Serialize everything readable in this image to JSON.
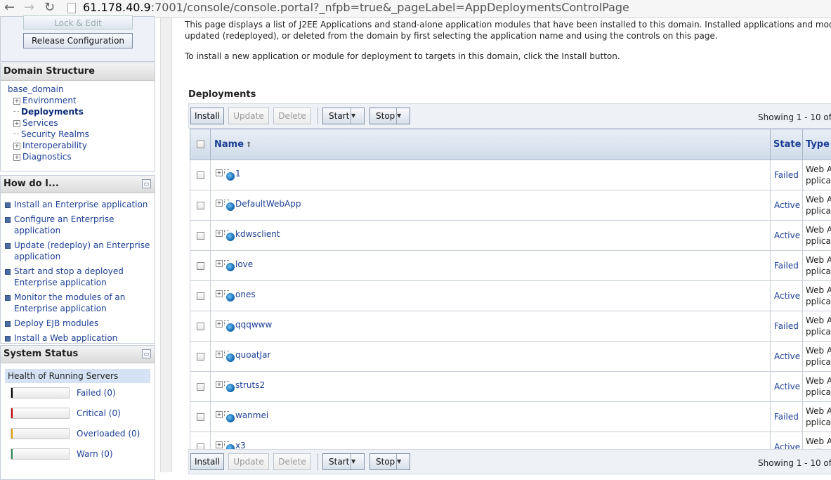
{
  "browser": {
    "url_host": "61.178.40.9",
    "url_rest": ":7001/console/console.portal?_nfpb=true&_pageLabel=AppDeploymentsControlPage"
  },
  "change_center": {
    "lock_edit": "Lock & Edit",
    "release_config": "Release Configuration"
  },
  "domain_structure": {
    "title": "Domain Structure",
    "root": "base_domain",
    "items": [
      {
        "label": "Environment",
        "expandable": true
      },
      {
        "label": "Deployments",
        "expandable": false,
        "selected": true
      },
      {
        "label": "Services",
        "expandable": true
      },
      {
        "label": "Security Realms",
        "expandable": false
      },
      {
        "label": "Interoperability",
        "expandable": true
      },
      {
        "label": "Diagnostics",
        "expandable": true
      }
    ]
  },
  "how_do_i": {
    "title": "How do I...",
    "items": [
      "Install an Enterprise application",
      "Configure an Enterprise application",
      "Update (redeploy) an Enterprise application",
      "Start and stop a deployed Enterprise application",
      "Monitor the modules of an Enterprise application",
      "Deploy EJB modules",
      "Install a Web application"
    ]
  },
  "system_status": {
    "title": "System Status",
    "health_label": "Health of Running Servers",
    "rows": [
      {
        "label": "Failed (0)",
        "color": "#000000"
      },
      {
        "label": "Critical (0)",
        "color": "#cc0000"
      },
      {
        "label": "Overloaded (0)",
        "color": "#e0a000"
      },
      {
        "label": "Warn (0)",
        "color": "#2e8b57"
      }
    ]
  },
  "main": {
    "intro_line1": "This page displays a list of J2EE Applications and stand-alone application modules that have been installed to this domain. Installed applications and modules can",
    "intro_line2": "updated (redeployed), or deleted from the domain by first selecting the application name and using the controls on this page.",
    "intro_line3": "To install a new application or module for deployment to targets in this domain, click the Install button.",
    "section_title": "Deployments",
    "toolbar": {
      "install": "Install",
      "update": "Update",
      "delete": "Delete",
      "start": "Start",
      "stop": "Stop",
      "showing": "Showing 1 - 10 of"
    },
    "table": {
      "headers": {
        "name": "Name",
        "state": "State",
        "type": "Type"
      },
      "rows": [
        {
          "name": "1",
          "state": "Failed",
          "type": "Web Applicat"
        },
        {
          "name": "DefaultWebApp",
          "state": "Active",
          "type": "Web Applicat"
        },
        {
          "name": "kdwsclient",
          "state": "Active",
          "type": "Web Applicat"
        },
        {
          "name": "love",
          "state": "Failed",
          "type": "Web Applicat"
        },
        {
          "name": "ones",
          "state": "Active",
          "type": "Web Applicat"
        },
        {
          "name": "qqqwww",
          "state": "Failed",
          "type": "Web Applicat"
        },
        {
          "name": "quoatJar",
          "state": "Active",
          "type": "Web Applicat"
        },
        {
          "name": "struts2",
          "state": "Active",
          "type": "Web Applicat"
        },
        {
          "name": "wanmei",
          "state": "Failed",
          "type": "Web Applicat"
        },
        {
          "name": "x3",
          "state": "Active",
          "type": "Web Applicat"
        }
      ]
    }
  }
}
